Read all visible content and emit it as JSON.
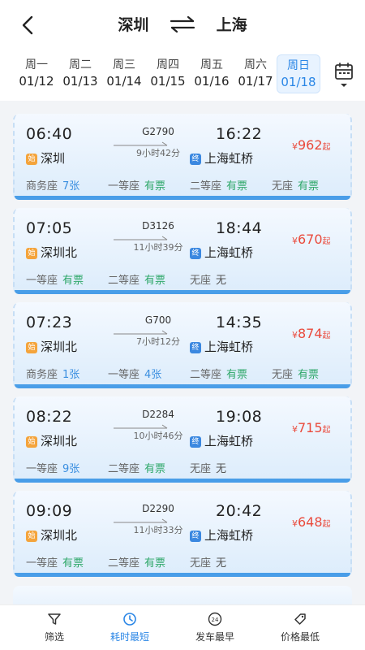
{
  "header": {
    "from": "深圳",
    "to": "上海"
  },
  "dates": [
    {
      "weekday": "周一",
      "date": "01/12"
    },
    {
      "weekday": "周二",
      "date": "01/13"
    },
    {
      "weekday": "周三",
      "date": "01/14"
    },
    {
      "weekday": "周四",
      "date": "01/15"
    },
    {
      "weekday": "周五",
      "date": "01/16"
    },
    {
      "weekday": "周六",
      "date": "01/17"
    },
    {
      "weekday": "周日",
      "date": "01/18",
      "selected": true
    }
  ],
  "badges": {
    "start": "始",
    "end": "终"
  },
  "currency": "¥",
  "price_suffix": "起",
  "trains": [
    {
      "dep_time": "06:40",
      "arr_time": "16:22",
      "train_no": "G2790",
      "duration": "9小时42分",
      "dep_station": "深圳",
      "arr_station": "上海虹桥",
      "price": "962",
      "seats": [
        {
          "type": "商务座",
          "avail": "7张"
        },
        {
          "type": "一等座",
          "avail": "有票"
        },
        {
          "type": "二等座",
          "avail": "有票"
        },
        {
          "type": "无座",
          "avail": "有票"
        }
      ]
    },
    {
      "dep_time": "07:05",
      "arr_time": "18:44",
      "train_no": "D3126",
      "duration": "11小时39分",
      "dep_station": "深圳北",
      "arr_station": "上海虹桥",
      "price": "670",
      "seats": [
        {
          "type": "一等座",
          "avail": "有票"
        },
        {
          "type": "二等座",
          "avail": "有票"
        },
        {
          "type": "无座",
          "avail": "无"
        }
      ]
    },
    {
      "dep_time": "07:23",
      "arr_time": "14:35",
      "train_no": "G700",
      "duration": "7小时12分",
      "dep_station": "深圳北",
      "arr_station": "上海虹桥",
      "price": "874",
      "seats": [
        {
          "type": "商务座",
          "avail": "1张"
        },
        {
          "type": "一等座",
          "avail": "4张"
        },
        {
          "type": "二等座",
          "avail": "有票"
        },
        {
          "type": "无座",
          "avail": "有票"
        }
      ]
    },
    {
      "dep_time": "08:22",
      "arr_time": "19:08",
      "train_no": "D2284",
      "duration": "10小时46分",
      "dep_station": "深圳北",
      "arr_station": "上海虹桥",
      "price": "715",
      "seats": [
        {
          "type": "一等座",
          "avail": "9张"
        },
        {
          "type": "二等座",
          "avail": "有票"
        },
        {
          "type": "无座",
          "avail": "无"
        }
      ]
    },
    {
      "dep_time": "09:09",
      "arr_time": "20:42",
      "train_no": "D2290",
      "duration": "11小时33分",
      "dep_station": "深圳北",
      "arr_station": "上海虹桥",
      "price": "648",
      "seats": [
        {
          "type": "一等座",
          "avail": "有票"
        },
        {
          "type": "二等座",
          "avail": "有票"
        },
        {
          "type": "无座",
          "avail": "无"
        }
      ]
    }
  ],
  "bottom_tabs": [
    {
      "label": "筛选",
      "icon": "filter-icon"
    },
    {
      "label": "耗时最短",
      "icon": "clock-icon",
      "active": true
    },
    {
      "label": "发车最早",
      "icon": "24h-icon"
    },
    {
      "label": "价格最低",
      "icon": "price-tag-icon"
    }
  ],
  "colors": {
    "accent": "#2a86e6",
    "price": "#ea4a3c",
    "available": "#2fa86a",
    "count": "#3b8fe0"
  }
}
